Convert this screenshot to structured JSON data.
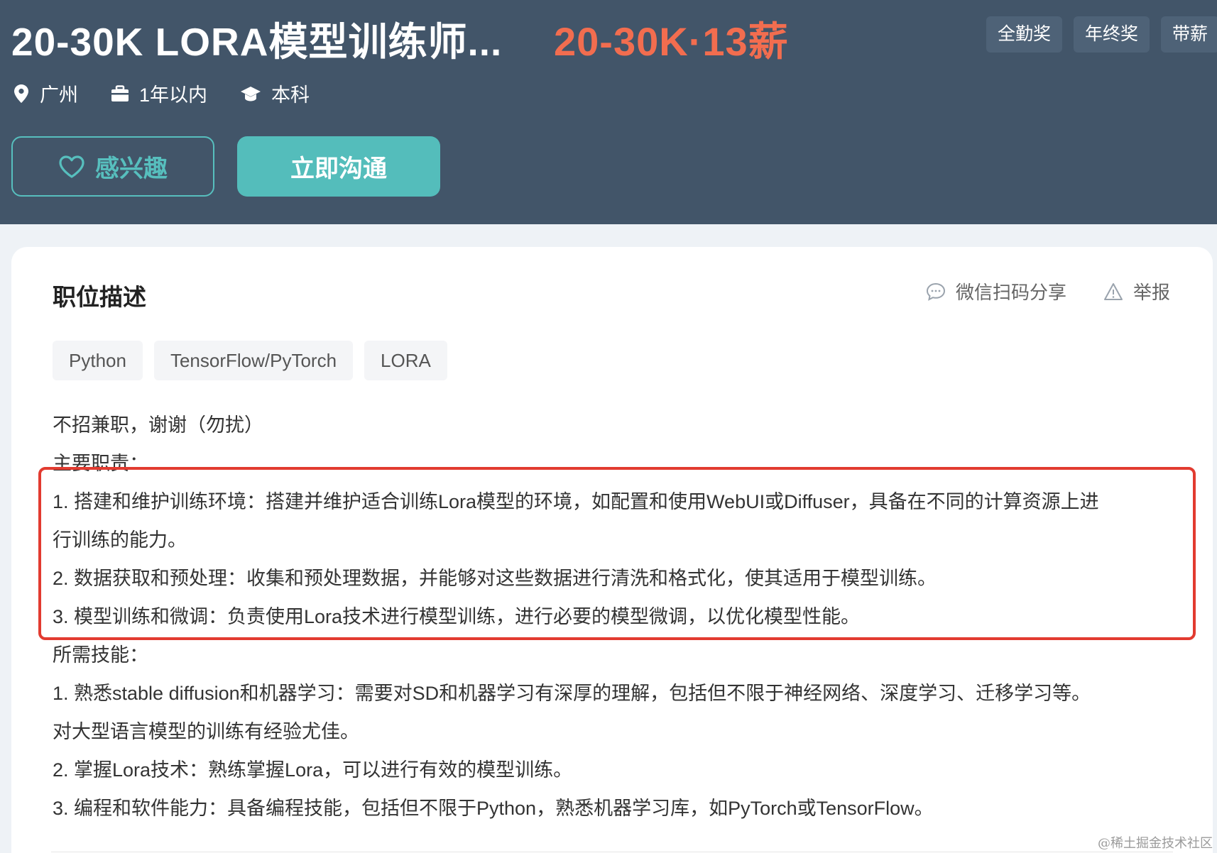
{
  "header": {
    "title": "20-30K LORA模型训练师...",
    "salary": "20-30K·13薪",
    "benefits": [
      "全勤奖",
      "年终奖",
      "带薪"
    ],
    "meta": {
      "location": "广州",
      "experience": "1年以内",
      "education": "本科"
    },
    "interest_label": "感兴趣",
    "chat_label": "立即沟通"
  },
  "detail": {
    "section_title": "职位描述",
    "share_label": "微信扫码分享",
    "report_label": "举报",
    "tags": [
      "Python",
      "TensorFlow/PyTorch",
      "LORA"
    ],
    "lines": [
      "不招兼职，谢谢（勿扰）",
      "主要职责：",
      "1. 搭建和维护训练环境：搭建并维护适合训练Lora模型的环境，如配置和使用WebUI或Diffuser，具备在不同的计算资源上进",
      "行训练的能力。",
      "2. 数据获取和预处理：收集和预处理数据，并能够对这些数据进行清洗和格式化，使其适用于模型训练。",
      "3. 模型训练和微调：负责使用Lora技术进行模型训练，进行必要的模型微调，以优化模型性能。",
      "所需技能：",
      "1. 熟悉stable diffusion和机器学习：需要对SD和机器学习有深厚的理解，包括但不限于神经网络、深度学习、迁移学习等。",
      "对大型语言模型的训练有经验尤佳。",
      "2. 掌握Lora技术：熟练掌握Lora，可以进行有效的模型训练。",
      "3. 编程和软件能力：具备编程技能，包括但不限于Python，熟悉机器学习库，如PyTorch或TensorFlow。"
    ]
  },
  "watermark": "@稀土掘金技术社区",
  "colors": {
    "header_bg": "#425569",
    "salary": "#f26d4f",
    "accent": "#54bdbb",
    "highlight": "#e23b30"
  },
  "icons": [
    "location-pin-icon",
    "briefcase-icon",
    "graduation-cap-icon",
    "heart-icon",
    "chat-bubble-icon",
    "warning-icon"
  ]
}
